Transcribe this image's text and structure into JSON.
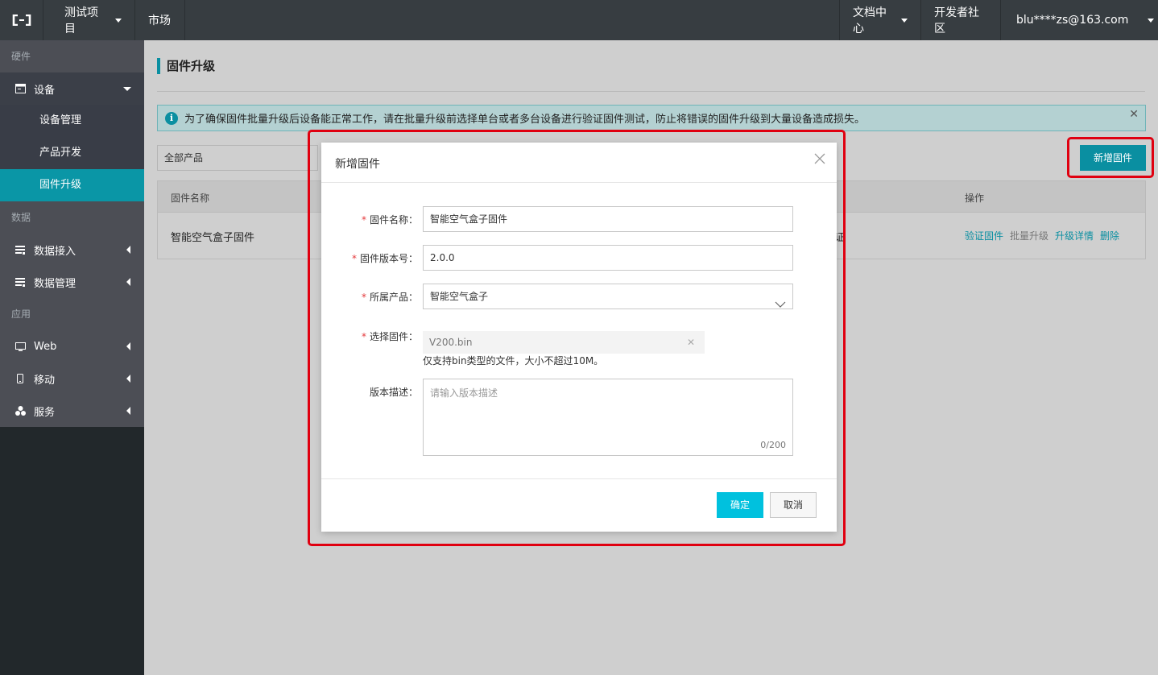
{
  "topbar": {
    "project": "测试项目",
    "market": "市场",
    "docs": "文档中心",
    "dev_community": "开发者社区",
    "user": "blu****zs@163.com"
  },
  "sidebar": {
    "sections": [
      {
        "title": "硬件"
      },
      {
        "title": "数据"
      },
      {
        "title": "应用"
      }
    ],
    "device": {
      "label": "设备",
      "icon": "device-icon"
    },
    "device_sub": [
      {
        "label": "设备管理"
      },
      {
        "label": "产品开发"
      },
      {
        "label": "固件升级"
      }
    ],
    "data_items": [
      {
        "label": "数据接入",
        "icon": "data-icon"
      },
      {
        "label": "数据管理",
        "icon": "data-icon"
      }
    ],
    "app_items": [
      {
        "label": "Web",
        "icon": "monitor-icon"
      },
      {
        "label": "移动",
        "icon": "mobile-icon"
      },
      {
        "label": "服务",
        "icon": "service-icon"
      }
    ]
  },
  "main": {
    "title": "固件升级",
    "alert": "为了确保固件批量升级后设备能正常工作，请在批量升级前选择单台或者多台设备进行验证固件测试，防止将错误的固件升级到大量设备造成损失。",
    "product_filter": "全部产品",
    "add_button": "新增固件",
    "table": {
      "headers": [
        "固件名称",
        "操作"
      ],
      "rows": [
        {
          "name": "智能空气盒子固件",
          "partial": "证",
          "ops": [
            "验证固件",
            "批量升级",
            "升级详情",
            "删除"
          ]
        }
      ]
    }
  },
  "modal": {
    "title": "新增固件",
    "fields": {
      "name_label": "固件名称：",
      "name_value": "智能空气盒子固件",
      "version_label": "固件版本号：",
      "version_value": "2.0.0",
      "product_label": "所属产品：",
      "product_value": "智能空气盒子",
      "file_label": "选择固件：",
      "file_value": "V200.bin",
      "file_hint": "仅支持bin类型的文件，大小不超过10M。",
      "desc_label": "版本描述：",
      "desc_placeholder": "请输入版本描述",
      "desc_count": "0/200"
    },
    "ok_button": "确定",
    "cancel_button": "取消",
    "required_mark": "*"
  },
  "colors": {
    "accent": "#0a8fa1",
    "primary_button": "#00c1de",
    "highlight_box": "#e00010"
  }
}
